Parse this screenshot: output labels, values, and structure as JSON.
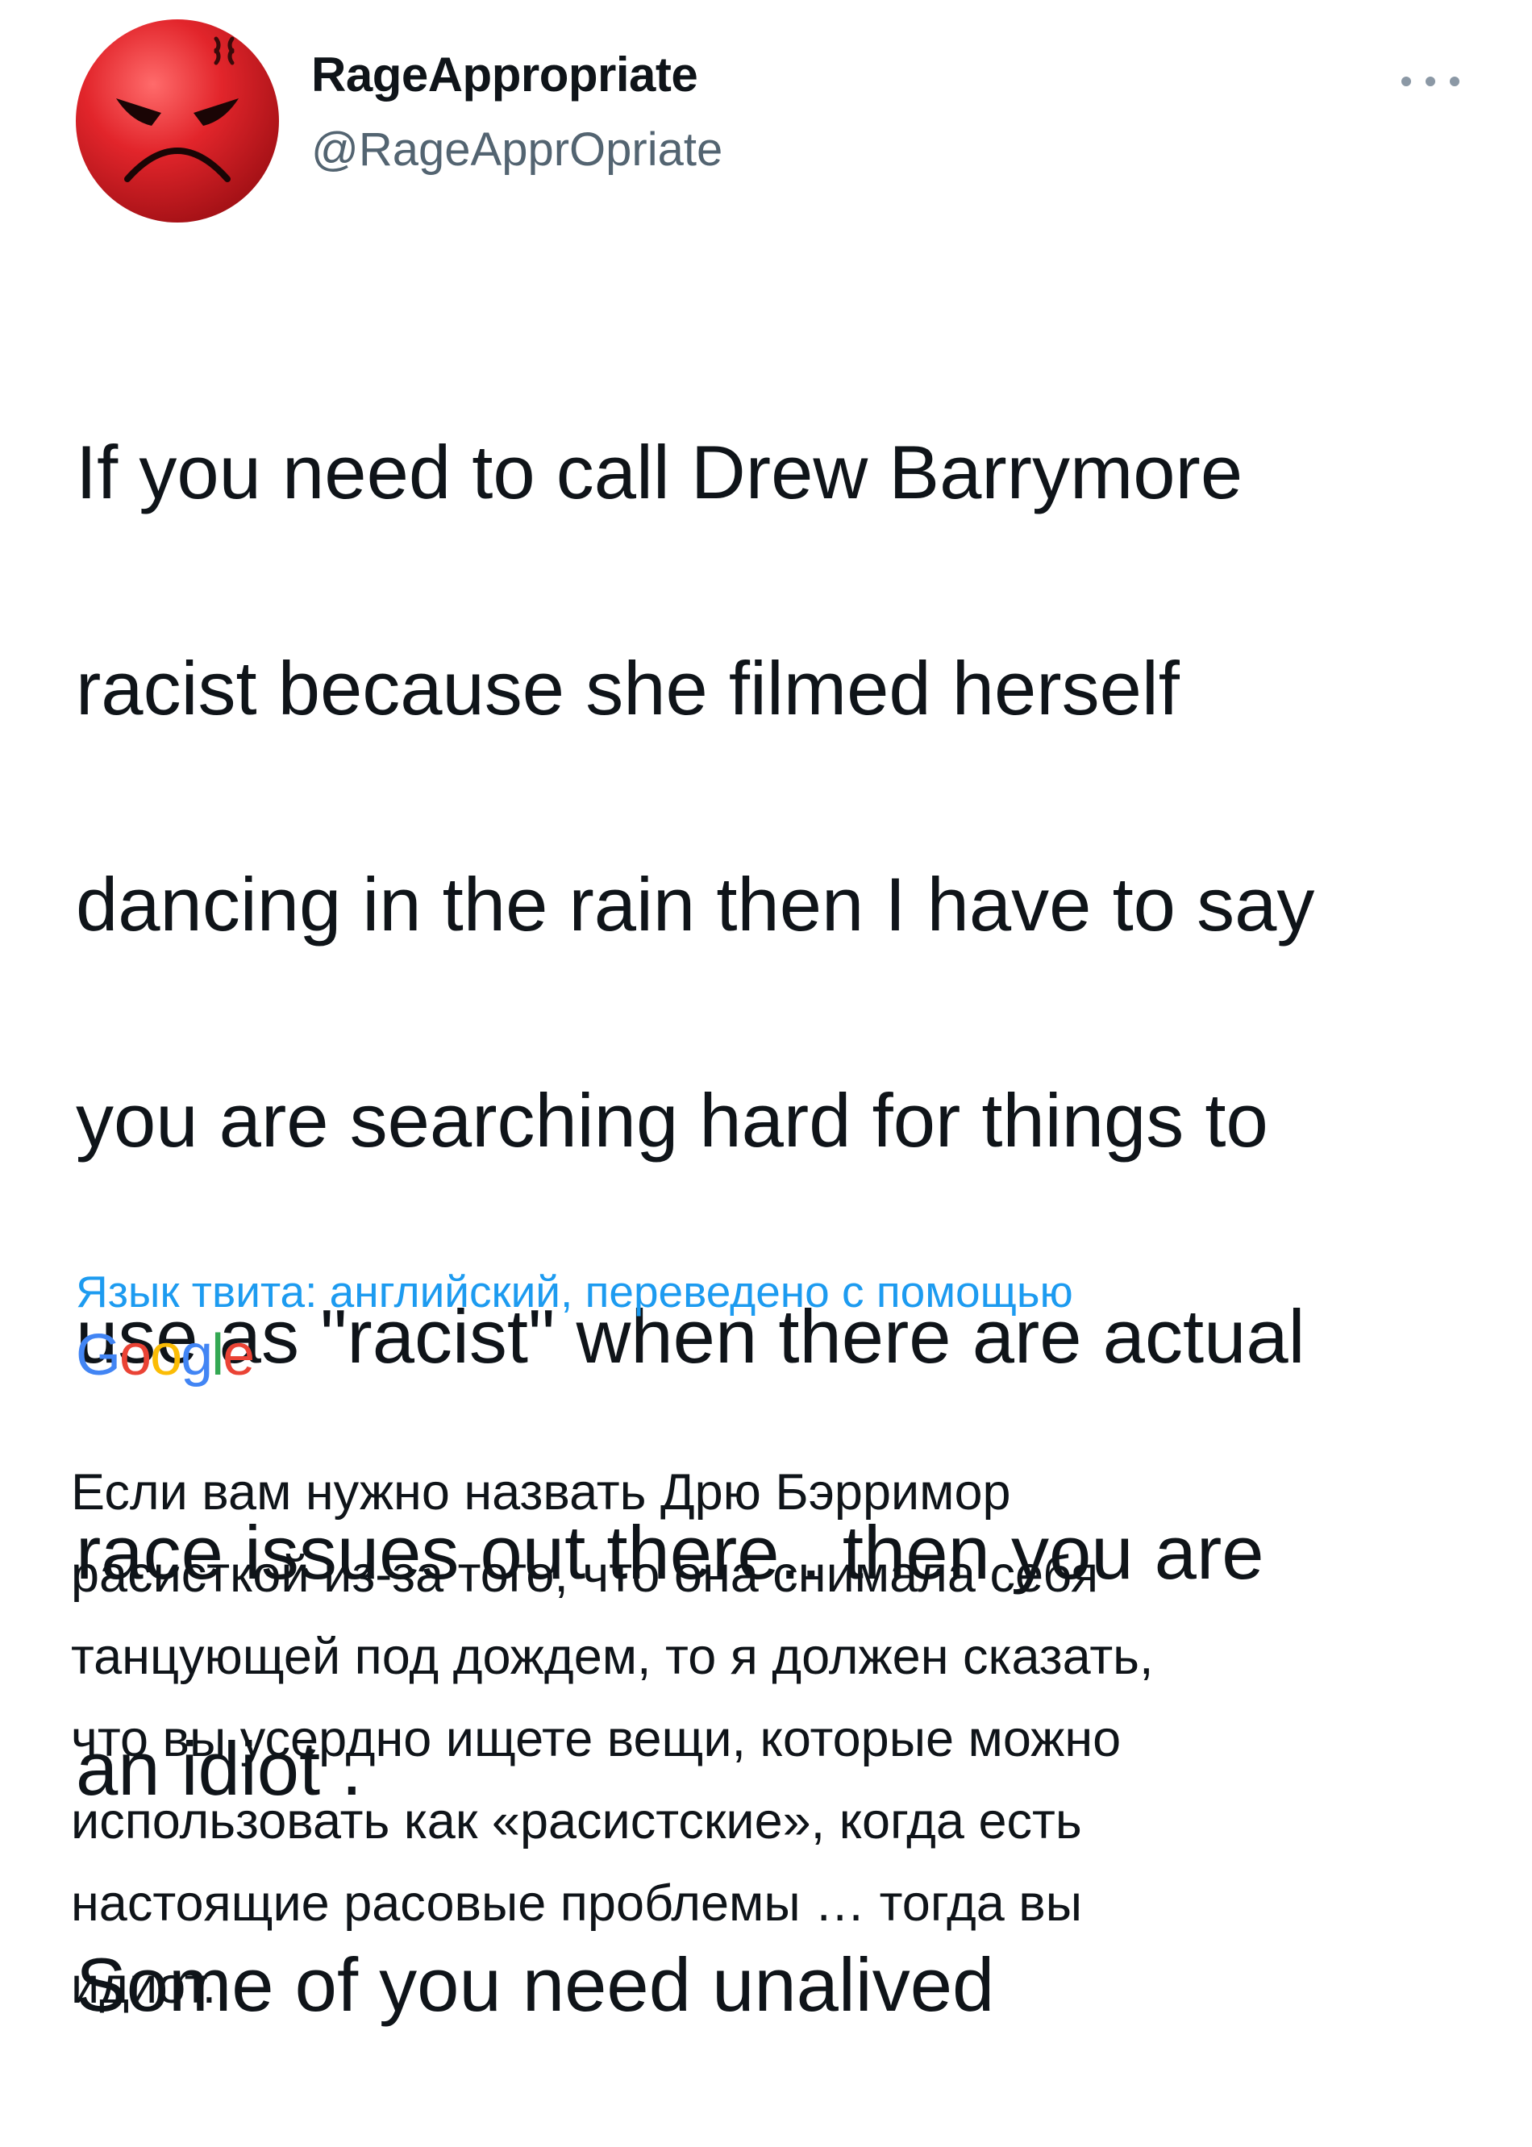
{
  "author": {
    "name": "RageAppropriate",
    "handle": "@RageApprOpriate",
    "avatar_icon": "angry-face-icon"
  },
  "more_icon": "more-dots-icon",
  "tweet": {
    "lines": [
      "If you need to call Drew Barrymore",
      "racist because she filmed herself",
      "dancing in the rain then I have to say",
      "you are searching hard for things to",
      "use as \"racist\" when there are actual",
      "race issues out there.. then you are",
      "an idiot .",
      "Some of you need unalived"
    ]
  },
  "translation": {
    "notice": "Язык твита: английский, переведено с помощью",
    "provider": "Google",
    "lines": [
      "Если вам нужно назвать Дрю Бэрримор",
      "расисткой из-за того, что она снимала себя",
      "танцующей под дождем, то я должен сказать,",
      "что вы усердно ищете вещи, которые можно",
      "использовать как «расистские», когда есть",
      "настоящие расовые проблемы … тогда вы",
      "идиот."
    ]
  },
  "colors": {
    "text": "#0f1419",
    "secondary": "#536471",
    "link": "#1d9bf0",
    "avatar_red": "#d21f26"
  }
}
